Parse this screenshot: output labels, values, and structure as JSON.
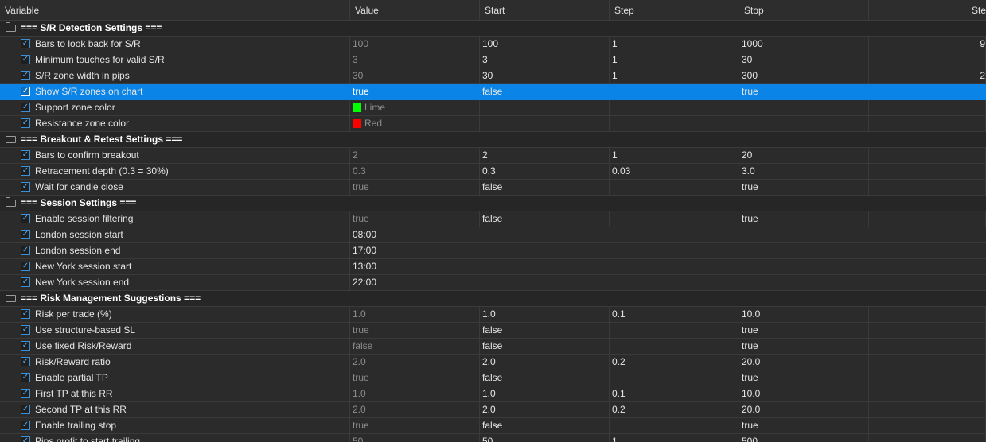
{
  "columns": {
    "variable": "Variable",
    "value": "Value",
    "start": "Start",
    "step": "Step",
    "stop": "Stop",
    "step_max_partial": "Ste"
  },
  "colors": {
    "selected_row": "#0a84e6",
    "lime": "#00ff00",
    "red": "#ff0000"
  },
  "groups": [
    {
      "label": "=== S/R Detection Settings ==="
    },
    {
      "label": "=== Breakout & Retest Settings ==="
    },
    {
      "label": "=== Session Settings ==="
    },
    {
      "label": "=== Risk Management Suggestions ==="
    }
  ],
  "rows": [
    {
      "label": "Bars to look back for S/R",
      "value": "100",
      "start": "100",
      "step": "1",
      "stop": "1000",
      "stepmax": "9"
    },
    {
      "label": "Minimum touches for valid S/R",
      "value": "3",
      "start": "3",
      "step": "1",
      "stop": "30",
      "stepmax": ""
    },
    {
      "label": "S/R zone width in pips",
      "value": "30",
      "start": "30",
      "step": "1",
      "stop": "300",
      "stepmax": "2"
    },
    {
      "label": "Show S/R zones on chart",
      "value": "true",
      "start": "false",
      "step": "",
      "stop": "true",
      "stepmax": ""
    },
    {
      "label": "Support zone color",
      "value": "Lime",
      "start": "",
      "step": "",
      "stop": "",
      "stepmax": ""
    },
    {
      "label": "Resistance zone color",
      "value": "Red",
      "start": "",
      "step": "",
      "stop": "",
      "stepmax": ""
    },
    {
      "label": "Bars to confirm breakout",
      "value": "2",
      "start": "2",
      "step": "1",
      "stop": "20",
      "stepmax": ""
    },
    {
      "label": "Retracement depth (0.3 = 30%)",
      "value": "0.3",
      "start": "0.3",
      "step": "0.03",
      "stop": "3.0",
      "stepmax": ""
    },
    {
      "label": "Wait for candle close",
      "value": "true",
      "start": "false",
      "step": "",
      "stop": "true",
      "stepmax": ""
    },
    {
      "label": "Enable session filtering",
      "value": "true",
      "start": "false",
      "step": "",
      "stop": "true",
      "stepmax": ""
    },
    {
      "label": "London session start",
      "value": "08:00",
      "start": "",
      "step": "",
      "stop": "",
      "stepmax": ""
    },
    {
      "label": "London session end",
      "value": "17:00",
      "start": "",
      "step": "",
      "stop": "",
      "stepmax": ""
    },
    {
      "label": "New York session start",
      "value": "13:00",
      "start": "",
      "step": "",
      "stop": "",
      "stepmax": ""
    },
    {
      "label": "New York session end",
      "value": "22:00",
      "start": "",
      "step": "",
      "stop": "",
      "stepmax": ""
    },
    {
      "label": "Risk per trade (%)",
      "value": "1.0",
      "start": "1.0",
      "step": "0.1",
      "stop": "10.0",
      "stepmax": ""
    },
    {
      "label": "Use structure-based SL",
      "value": "true",
      "start": "false",
      "step": "",
      "stop": "true",
      "stepmax": ""
    },
    {
      "label": "Use fixed Risk/Reward",
      "value": "false",
      "start": "false",
      "step": "",
      "stop": "true",
      "stepmax": ""
    },
    {
      "label": "Risk/Reward ratio",
      "value": "2.0",
      "start": "2.0",
      "step": "0.2",
      "stop": "20.0",
      "stepmax": ""
    },
    {
      "label": "Enable partial TP",
      "value": "true",
      "start": "false",
      "step": "",
      "stop": "true",
      "stepmax": ""
    },
    {
      "label": "First TP at this RR",
      "value": "1.0",
      "start": "1.0",
      "step": "0.1",
      "stop": "10.0",
      "stepmax": ""
    },
    {
      "label": "Second TP at this RR",
      "value": "2.0",
      "start": "2.0",
      "step": "0.2",
      "stop": "20.0",
      "stepmax": ""
    },
    {
      "label": "Enable trailing stop",
      "value": "true",
      "start": "false",
      "step": "",
      "stop": "true",
      "stepmax": ""
    },
    {
      "label": "Pips profit to start trailing",
      "value": "50",
      "start": "50",
      "step": "1",
      "stop": "500",
      "stepmax": ""
    }
  ]
}
